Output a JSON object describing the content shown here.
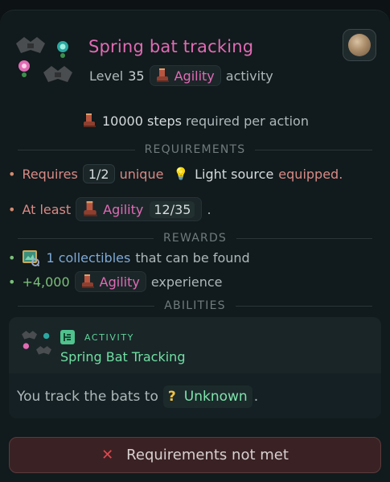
{
  "header": {
    "title": "Spring bat tracking",
    "level_label": "Level",
    "level_value": "35",
    "skill": "Agility",
    "type_label": "activity"
  },
  "steps": {
    "count": "10000 steps",
    "suffix": "required per action"
  },
  "sections": {
    "requirements": "REQUIREMENTS",
    "rewards": "REWARDS",
    "abilities": "ABILITIES"
  },
  "requirements": {
    "line1": {
      "prefix": "Requires",
      "count": "1/2",
      "unique": "unique",
      "item": "Light source",
      "suffix": "equipped."
    },
    "line2": {
      "prefix": "At least",
      "skill": "Agility",
      "progress": "12/35",
      "suffix": "."
    }
  },
  "rewards": {
    "line1": {
      "count": "1 collectibles",
      "suffix": "that can be found"
    },
    "line2": {
      "amount": "+4,000",
      "skill": "Agility",
      "suffix": "experience"
    }
  },
  "ability": {
    "tag": "ACTIVITY",
    "name": "Spring Bat Tracking",
    "desc_prefix": "You track the bats to",
    "location": "Unknown",
    "desc_suffix": "."
  },
  "status_button": {
    "label": "Requirements not met"
  },
  "icons": {
    "header": "spring-bat-tracking-icon",
    "avatar": "character-avatar-icon",
    "boot": "agility-boot-icon",
    "bulb": "light-bulb-icon",
    "collectible": "collectible-map-icon",
    "ability_tag": "activity-tag-icon",
    "question": "question-mark-icon",
    "close": "close-icon"
  },
  "colors": {
    "title": "#e06bb4",
    "ability": "#6fe0a2",
    "error": "#e0474d"
  }
}
